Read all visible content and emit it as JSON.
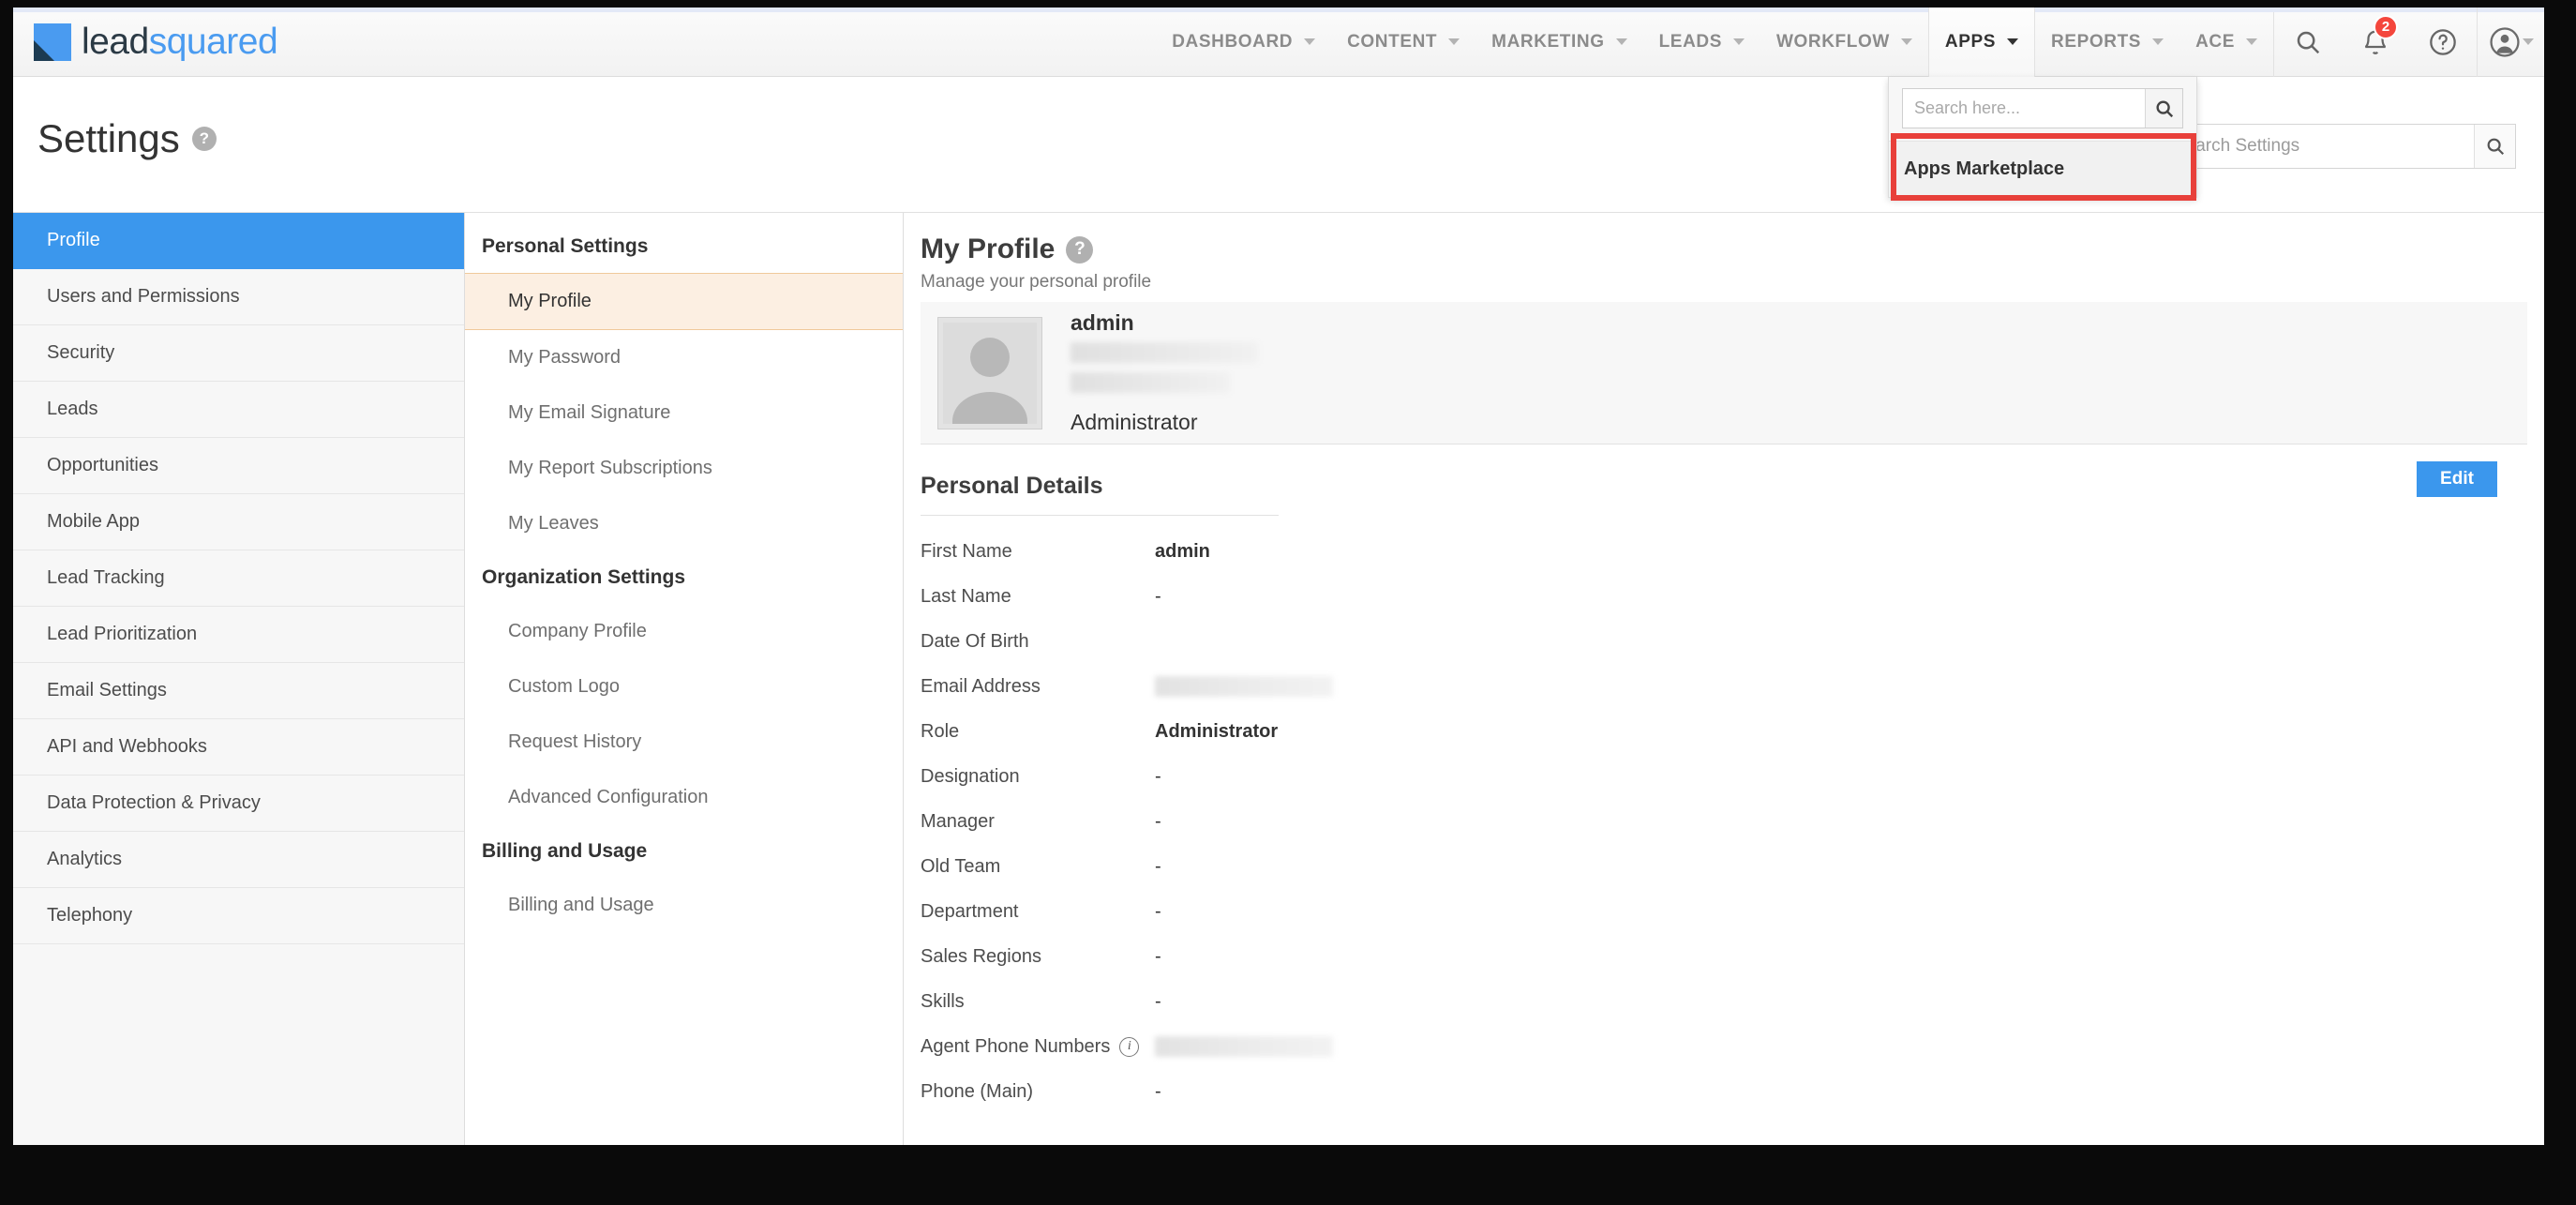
{
  "brand": {
    "name_lead": "lead",
    "name_squared": "squared",
    "accent": "#4a9bf0"
  },
  "topnav": {
    "items": [
      {
        "label": "DASHBOARD",
        "active": false
      },
      {
        "label": "CONTENT",
        "active": false
      },
      {
        "label": "MARKETING",
        "active": false
      },
      {
        "label": "LEADS",
        "active": false
      },
      {
        "label": "WORKFLOW",
        "active": false
      },
      {
        "label": "APPS",
        "active": true
      },
      {
        "label": "REPORTS",
        "active": false
      },
      {
        "label": "ACE",
        "active": false
      }
    ],
    "icons": [
      {
        "name": "search-icon"
      },
      {
        "name": "notification-bell-icon",
        "badge": "2"
      },
      {
        "name": "help-icon"
      },
      {
        "name": "user-avatar-icon"
      }
    ],
    "notification_count": "2"
  },
  "apps_dropdown": {
    "search_placeholder": "Search here...",
    "search_value": "",
    "items": [
      {
        "label": "Apps Marketplace",
        "highlighted": true
      }
    ],
    "highlight_color": "#e8403a"
  },
  "page_header": {
    "title": "Settings",
    "help_label": "?"
  },
  "settings_search": {
    "placeholder": "Search Settings",
    "value": ""
  },
  "sidebar": {
    "items": [
      {
        "label": "Profile",
        "active": true
      },
      {
        "label": "Users and Permissions",
        "active": false
      },
      {
        "label": "Security",
        "active": false
      },
      {
        "label": "Leads",
        "active": false
      },
      {
        "label": "Opportunities",
        "active": false
      },
      {
        "label": "Mobile App",
        "active": false
      },
      {
        "label": "Lead Tracking",
        "active": false
      },
      {
        "label": "Lead Prioritization",
        "active": false
      },
      {
        "label": "Email Settings",
        "active": false
      },
      {
        "label": "API and Webhooks",
        "active": false
      },
      {
        "label": "Data Protection & Privacy",
        "active": false
      },
      {
        "label": "Analytics",
        "active": false
      },
      {
        "label": "Telephony",
        "active": false
      }
    ]
  },
  "submenu": {
    "groups": [
      {
        "title": "Personal Settings",
        "items": [
          {
            "label": "My Profile",
            "active": true
          },
          {
            "label": "My Password",
            "active": false
          },
          {
            "label": "My Email Signature",
            "active": false
          },
          {
            "label": "My Report Subscriptions",
            "active": false
          },
          {
            "label": "My Leaves",
            "active": false
          }
        ]
      },
      {
        "title": "Organization Settings",
        "items": [
          {
            "label": "Company Profile",
            "active": false
          },
          {
            "label": "Custom Logo",
            "active": false
          },
          {
            "label": "Request History",
            "active": false
          },
          {
            "label": "Advanced Configuration",
            "active": false
          }
        ]
      },
      {
        "title": "Billing and Usage",
        "items": [
          {
            "label": "Billing and Usage",
            "active": false
          }
        ]
      }
    ]
  },
  "main": {
    "title": "My Profile",
    "subtitle": "Manage your personal profile",
    "profile_card": {
      "name": "admin",
      "email_masked": "",
      "phone_masked": "",
      "role": "Administrator"
    },
    "details_title": "Personal Details",
    "edit_label": "Edit",
    "details": [
      {
        "label": "First Name",
        "value": "admin",
        "bold": true,
        "masked": false
      },
      {
        "label": "Last Name",
        "value": "-",
        "bold": false,
        "masked": false
      },
      {
        "label": "Date Of Birth",
        "value": "",
        "bold": false,
        "masked": false
      },
      {
        "label": "Email Address",
        "value": "",
        "bold": false,
        "masked": true
      },
      {
        "label": "Role",
        "value": "Administrator",
        "bold": true,
        "masked": false
      },
      {
        "label": "Designation",
        "value": "-",
        "bold": false,
        "masked": false
      },
      {
        "label": "Manager",
        "value": "-",
        "bold": false,
        "masked": false
      },
      {
        "label": "Old Team",
        "value": "-",
        "bold": false,
        "masked": false
      },
      {
        "label": "Department",
        "value": "-",
        "bold": false,
        "masked": false
      },
      {
        "label": "Sales Regions",
        "value": "-",
        "bold": false,
        "masked": false
      },
      {
        "label": "Skills",
        "value": "-",
        "bold": false,
        "masked": false
      },
      {
        "label": "Agent Phone Numbers",
        "value": "",
        "bold": false,
        "masked": true,
        "info": true
      },
      {
        "label": "Phone (Main)",
        "value": "-",
        "bold": false,
        "masked": false
      }
    ]
  }
}
